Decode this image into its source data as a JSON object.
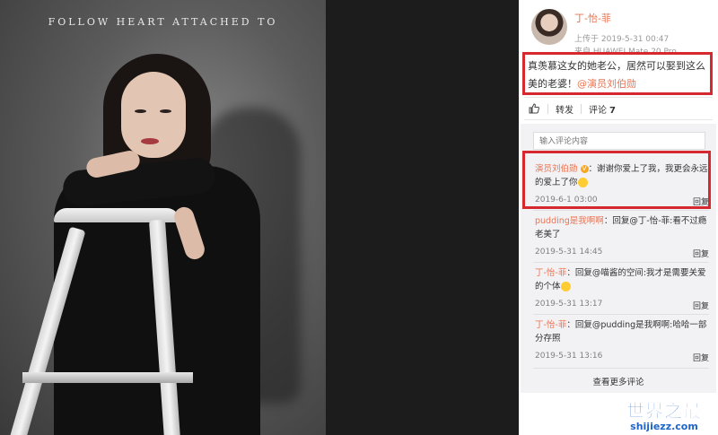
{
  "photo": {
    "title": "FOLLOW HEART ATTACHED TO"
  },
  "post": {
    "username": "丁-怡-菲",
    "posted": "上传于 2019-5-31 00:47",
    "device": "来自 HUAWEI Mate 20 Pro",
    "text": "真羡慕这女的她老公，居然可以娶到这么美的老婆！",
    "mention": "@演员刘伯勋"
  },
  "actions": {
    "like_icon": "thumbs-up-icon",
    "repost_label": "转发",
    "comment_label": "评论",
    "comment_count": "7"
  },
  "comment_input": {
    "placeholder": "输入评论内容"
  },
  "comments": [
    {
      "author": "演员刘伯勋",
      "verified_icon": "verified-badge-icon",
      "text": "：谢谢你爱上了我，我更会永远的爱上了你",
      "time": "2019-6-1 03:00",
      "reply": "回复"
    },
    {
      "author": "pudding是我啊啊",
      "text": "：回复@丁-怡-菲:看不过瘾 老美了",
      "time": "2019-5-31 14:45",
      "reply": "回复"
    },
    {
      "author": "丁-怡-菲",
      "text": "：回复@喵酱的空间:我才是需要关爱的个体",
      "time": "2019-5-31 13:17",
      "reply": "回复"
    },
    {
      "author": "丁-怡-菲",
      "text": "：回复@pudding是我啊啊:哈哈一部分存照",
      "time": "2019-5-31 13:16",
      "reply": "回复"
    }
  ],
  "more_comments": "查看更多评论",
  "watermark": {
    "cn": "世界之最",
    "en": "shijiezz.com"
  },
  "colors": {
    "accent": "#eb7350",
    "highlight_box": "#d6282f",
    "watermark": "#1f64c8"
  }
}
